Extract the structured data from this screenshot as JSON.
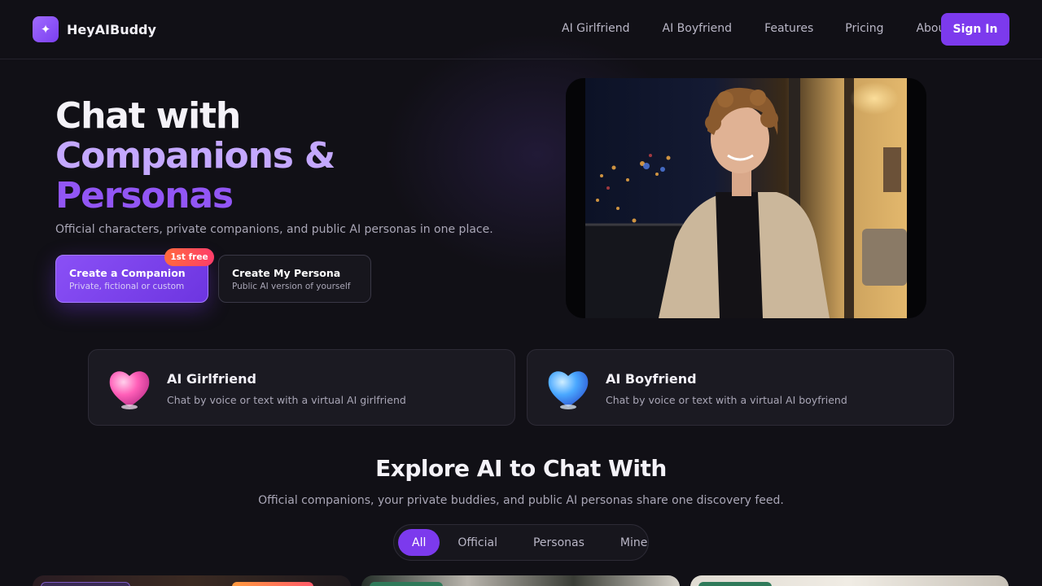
{
  "brand": {
    "name": "HeyAIBuddy",
    "logo_icon": "sparkle-icon"
  },
  "nav": {
    "links": [
      "AI Girlfriend",
      "AI Boyfriend",
      "Features",
      "Pricing",
      "About"
    ],
    "signin_label": "Sign In"
  },
  "hero": {
    "title_line1": "Chat with",
    "title_line2": "Companions &",
    "title_line3": "Personas",
    "subtitle": "Official characters, private companions, and public AI personas in one place.",
    "cta_primary": {
      "title": "Create a Companion",
      "desc": "Private, fictional or custom",
      "badge": "1st free"
    },
    "cta_secondary": {
      "title": "Create My Persona",
      "desc": "Public AI version of yourself"
    }
  },
  "categories": [
    {
      "title": "AI Girlfriend",
      "desc": "Chat by voice or text with a virtual AI girlfriend",
      "icon": "pink-heart-icon"
    },
    {
      "title": "AI Boyfriend",
      "desc": "Chat by voice or text with a virtual AI boyfriend",
      "icon": "blue-heart-icon"
    }
  ],
  "explore": {
    "title": "Explore AI to Chat With",
    "subtitle": "Official companions, your private buddies, and public AI personas share one discovery feed.",
    "filters": [
      "All",
      "Official",
      "Personas",
      "Mine"
    ],
    "active_filter": "All"
  },
  "colors": {
    "accent": "#7c3aed",
    "background": "#111016",
    "badge": "#ff5a4a"
  }
}
